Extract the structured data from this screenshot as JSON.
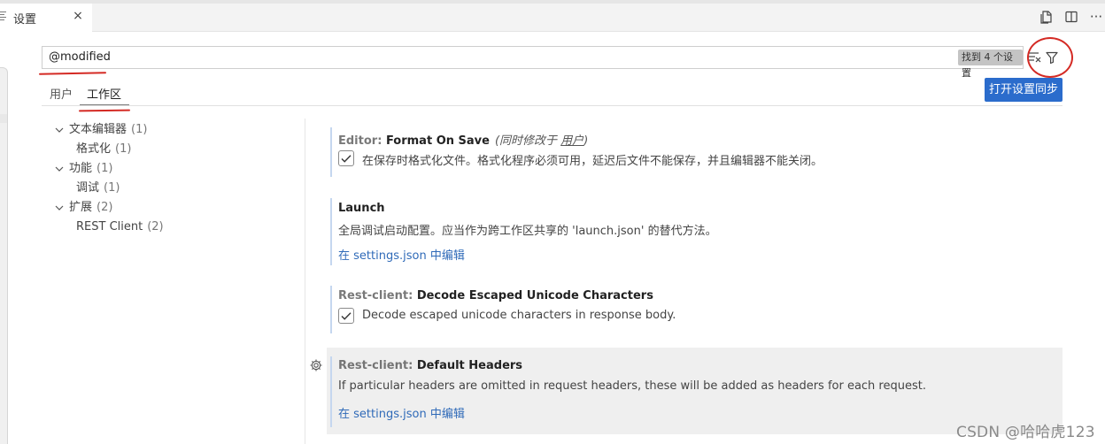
{
  "tab": {
    "label": "设置",
    "close_glyph": "×"
  },
  "top_actions": [
    {
      "icon": "open-json-icon"
    },
    {
      "icon": "split-editor-icon"
    },
    {
      "icon": "more-actions-icon",
      "glyph": "···"
    }
  ],
  "search": {
    "value": "@modified",
    "result_badge": "找到 4 个设置"
  },
  "scope_tabs": [
    {
      "label": "用户",
      "active": false
    },
    {
      "label": "工作区",
      "active": true
    }
  ],
  "sync_button": {
    "label": "打开设置同步"
  },
  "tree": [
    {
      "label": "文本编辑器",
      "count": "(1)",
      "expandable": true
    },
    {
      "label": "格式化",
      "count": "(1)",
      "expandable": false
    },
    {
      "label": "功能",
      "count": "(1)",
      "expandable": true
    },
    {
      "label": "调试",
      "count": "(1)",
      "expandable": false
    },
    {
      "label": "扩展",
      "count": "(2)",
      "expandable": true
    },
    {
      "label": "REST Client",
      "count": "(2)",
      "expandable": false
    }
  ],
  "settings": [
    {
      "category": "Editor: ",
      "name": "Format On Save",
      "modified_prefix": "(同时修改于 ",
      "modified_link": "用户",
      "modified_suffix": ")",
      "description": "在保存时格式化文件。格式化程序必须可用，延迟后文件不能保存，并且编辑器不能关闭。",
      "checked": true
    },
    {
      "category": "",
      "name": "Launch",
      "description": "全局调试启动配置。应当作为跨工作区共享的 'launch.json' 的替代方法。",
      "edit_link": "在 settings.json 中编辑"
    },
    {
      "category": "Rest-client: ",
      "name": "Decode Escaped Unicode Characters",
      "description": "Decode escaped unicode characters in response body.",
      "checked": true
    },
    {
      "category": "Rest-client: ",
      "name": "Default Headers",
      "description": "If particular headers are omitted in request headers, these will be added as headers for each request.",
      "edit_link": "在 settings.json 中编辑",
      "focused": true
    }
  ],
  "watermark": "CSDN @哈哈虎123",
  "colors": {
    "accent": "#2b6ccc",
    "link": "#2f6ab8",
    "annotation": "#d42a24"
  }
}
